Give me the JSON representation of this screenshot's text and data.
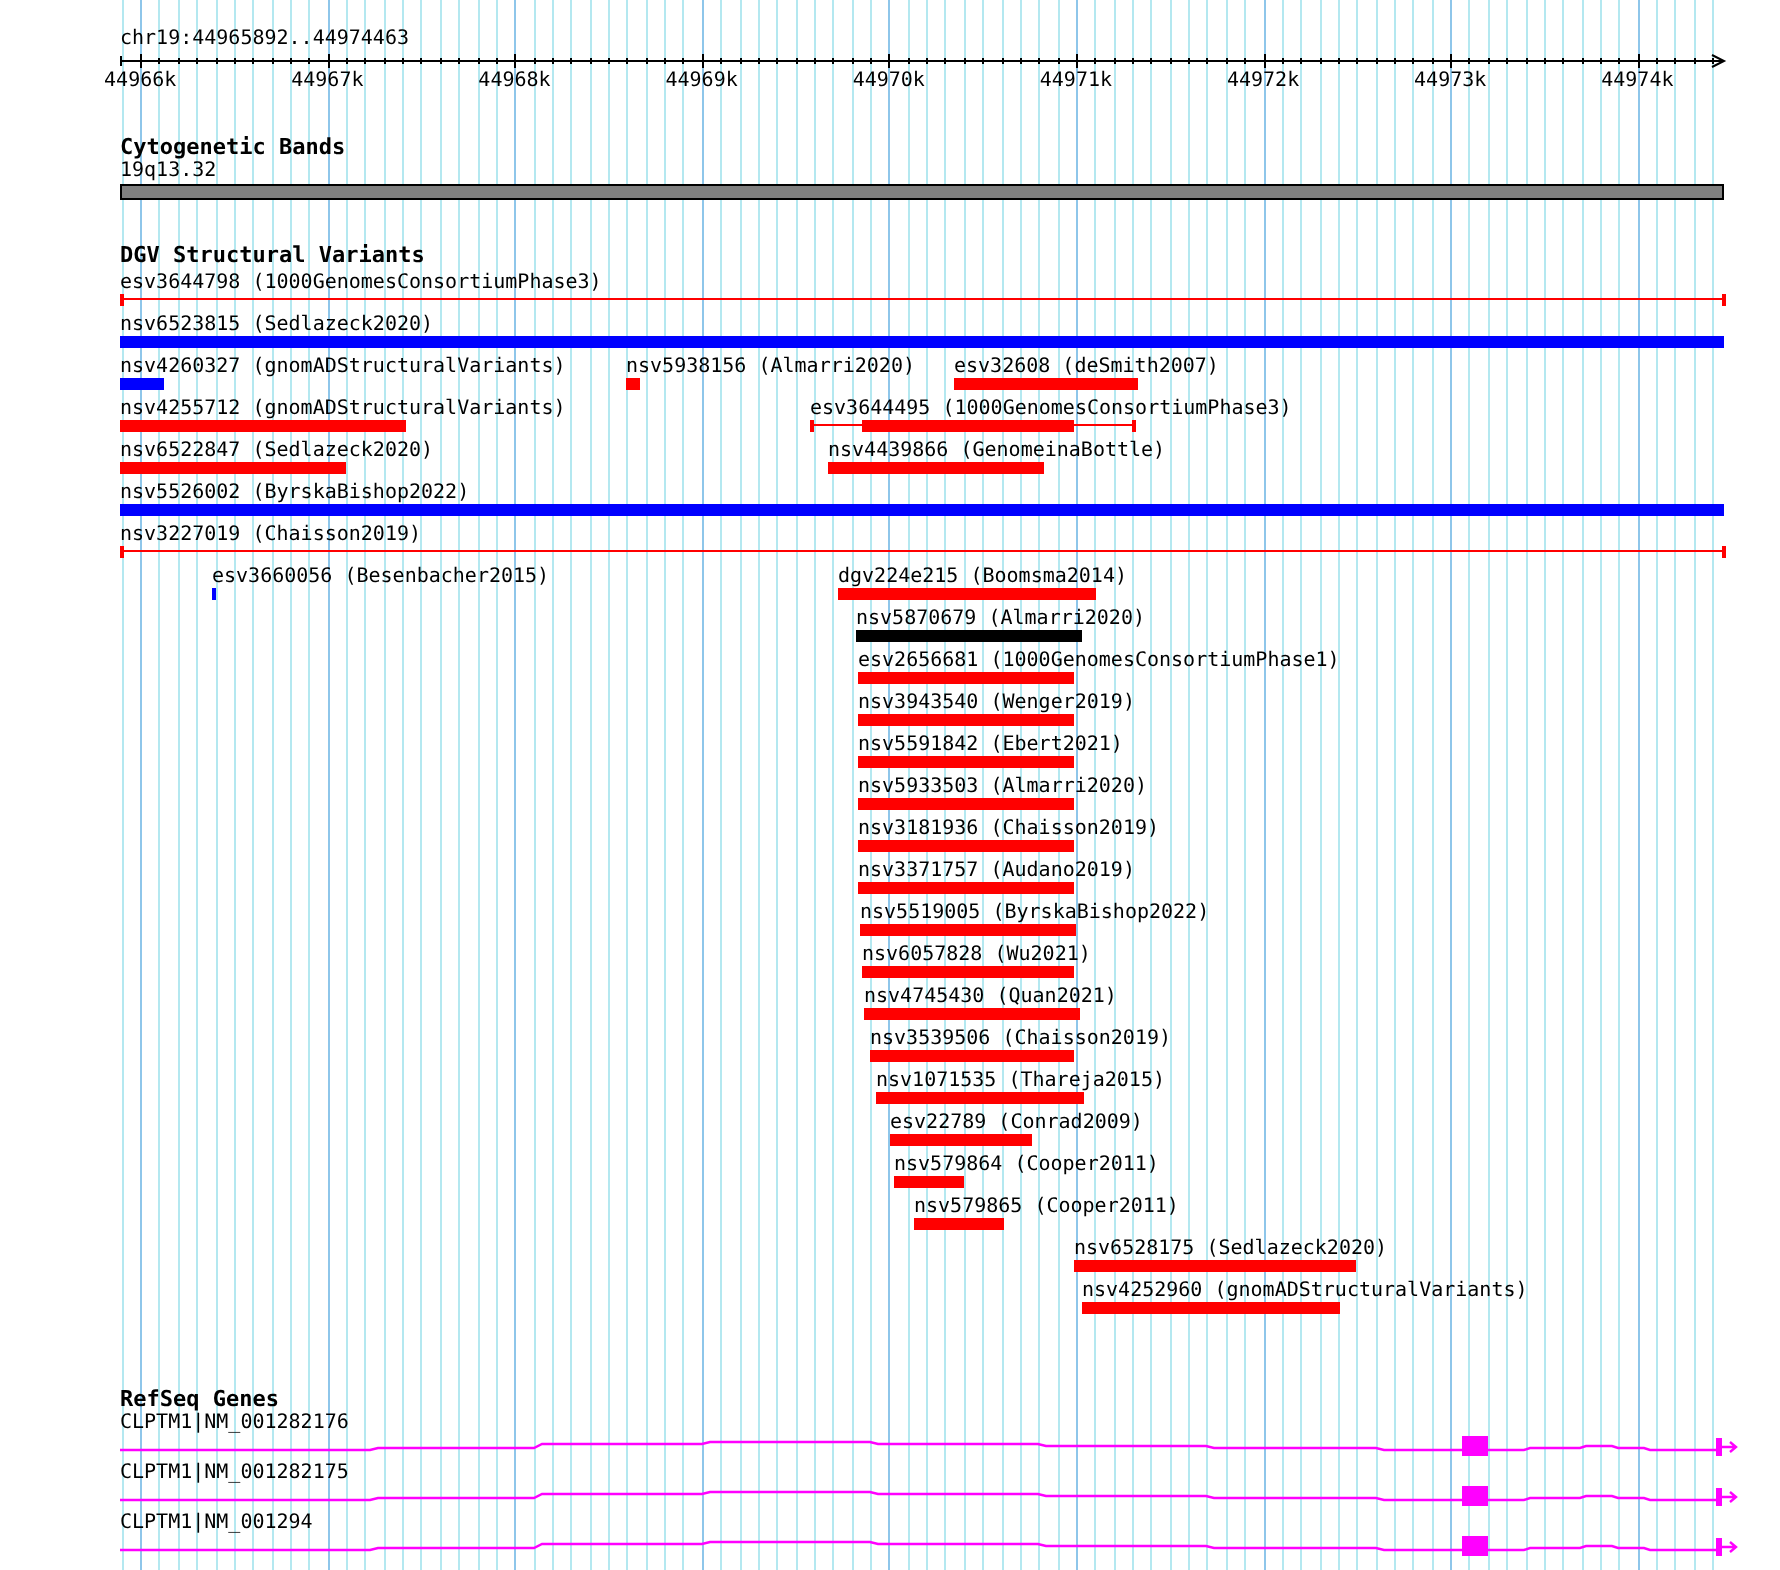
{
  "ruler": {
    "region": "chr19:44965892..44974463",
    "ticks": [
      "44966k",
      "44967k",
      "44968k",
      "44969k",
      "44970k",
      "44971k",
      "44972k",
      "44973k",
      "44974k"
    ]
  },
  "tracks": [
    {
      "title": "Cytogenetic Bands",
      "kind": "bands",
      "features": [
        {
          "label": "19q13.32",
          "color": "#808080"
        }
      ]
    },
    {
      "title": "DGV Structural Variants",
      "kind": "variants",
      "rows": [
        {
          "features": [
            {
              "label": "esv3644798 (1000GenomesConsortiumPhase3)",
              "kind": "line",
              "color": "#ff0000"
            }
          ]
        },
        {
          "features": [
            {
              "label": "nsv6523815 (Sedlazeck2020)",
              "kind": "bar",
              "color": "#0000ff"
            }
          ]
        },
        {
          "features": [
            {
              "label": "nsv4260327 (gnomADStructuralVariants)",
              "kind": "bar",
              "color": "#0000ff"
            },
            {
              "label": "nsv5938156 (Almarri2020)",
              "kind": "bar",
              "color": "#ff0000"
            },
            {
              "label": "esv32608 (deSmith2007)",
              "kind": "bar",
              "color": "#ff0000"
            }
          ]
        },
        {
          "features": [
            {
              "label": "nsv4255712 (gnomADStructuralVariants)",
              "kind": "bar",
              "color": "#ff0000"
            },
            {
              "label": "esv3644495 (1000GenomesConsortiumPhase3)",
              "kind": "gapped",
              "color": "#ff0000"
            }
          ]
        },
        {
          "features": [
            {
              "label": "nsv6522847 (Sedlazeck2020)",
              "kind": "bar",
              "color": "#ff0000"
            },
            {
              "label": "nsv4439866 (GenomeinaBottle)",
              "kind": "bar",
              "color": "#ff0000"
            }
          ]
        },
        {
          "features": [
            {
              "label": "nsv5526002 (ByrskaBishop2022)",
              "kind": "bar",
              "color": "#0000ff"
            }
          ]
        },
        {
          "features": [
            {
              "label": "nsv3227019 (Chaisson2019)",
              "kind": "line",
              "color": "#ff0000"
            }
          ]
        },
        {
          "features": [
            {
              "label": "esv3660056 (Besenbacher2015)",
              "kind": "bar",
              "color": "#0000ff"
            },
            {
              "label": "dgv224e215 (Boomsma2014)",
              "kind": "bar",
              "color": "#ff0000"
            }
          ]
        },
        {
          "features": [
            {
              "label": "nsv5870679 (Almarri2020)",
              "kind": "bar",
              "color": "#000000"
            }
          ]
        },
        {
          "features": [
            {
              "label": "esv2656681 (1000GenomesConsortiumPhase1)",
              "kind": "bar",
              "color": "#ff0000"
            }
          ]
        },
        {
          "features": [
            {
              "label": "nsv3943540 (Wenger2019)",
              "kind": "bar",
              "color": "#ff0000"
            }
          ]
        },
        {
          "features": [
            {
              "label": "nsv5591842 (Ebert2021)",
              "kind": "bar",
              "color": "#ff0000"
            }
          ]
        },
        {
          "features": [
            {
              "label": "nsv5933503 (Almarri2020)",
              "kind": "bar",
              "color": "#ff0000"
            }
          ]
        },
        {
          "features": [
            {
              "label": "nsv3181936 (Chaisson2019)",
              "kind": "bar",
              "color": "#ff0000"
            }
          ]
        },
        {
          "features": [
            {
              "label": "nsv3371757 (Audano2019)",
              "kind": "bar",
              "color": "#ff0000"
            }
          ]
        },
        {
          "features": [
            {
              "label": "nsv5519005 (ByrskaBishop2022)",
              "kind": "bar",
              "color": "#ff0000"
            }
          ]
        },
        {
          "features": [
            {
              "label": "nsv6057828 (Wu2021)",
              "kind": "bar",
              "color": "#ff0000"
            }
          ]
        },
        {
          "features": [
            {
              "label": "nsv4745430 (Quan2021)",
              "kind": "bar",
              "color": "#ff0000"
            }
          ]
        },
        {
          "features": [
            {
              "label": "nsv3539506 (Chaisson2019)",
              "kind": "bar",
              "color": "#ff0000"
            }
          ]
        },
        {
          "features": [
            {
              "label": "nsv1071535 (Thareja2015)",
              "kind": "bar",
              "color": "#ff0000"
            }
          ]
        },
        {
          "features": [
            {
              "label": "esv22789 (Conrad2009)",
              "kind": "bar",
              "color": "#ff0000"
            }
          ]
        },
        {
          "features": [
            {
              "label": "nsv579864 (Cooper2011)",
              "kind": "bar",
              "color": "#ff0000"
            }
          ]
        },
        {
          "features": [
            {
              "label": "nsv579865 (Cooper2011)",
              "kind": "bar",
              "color": "#ff0000"
            }
          ]
        },
        {
          "features": [
            {
              "label": "nsv6528175 (Sedlazeck2020)",
              "kind": "bar",
              "color": "#ff0000"
            }
          ]
        },
        {
          "features": [
            {
              "label": "nsv4252960 (gnomADStructuralVariants)",
              "kind": "bar",
              "color": "#ff0000"
            }
          ]
        }
      ]
    },
    {
      "title": "RefSeq Genes",
      "kind": "genes",
      "features": [
        {
          "label": "CLPTM1|NM_001282176"
        },
        {
          "label": "CLPTM1|NM_001282175"
        },
        {
          "label": "CLPTM1|NM_001294"
        }
      ]
    }
  ]
}
